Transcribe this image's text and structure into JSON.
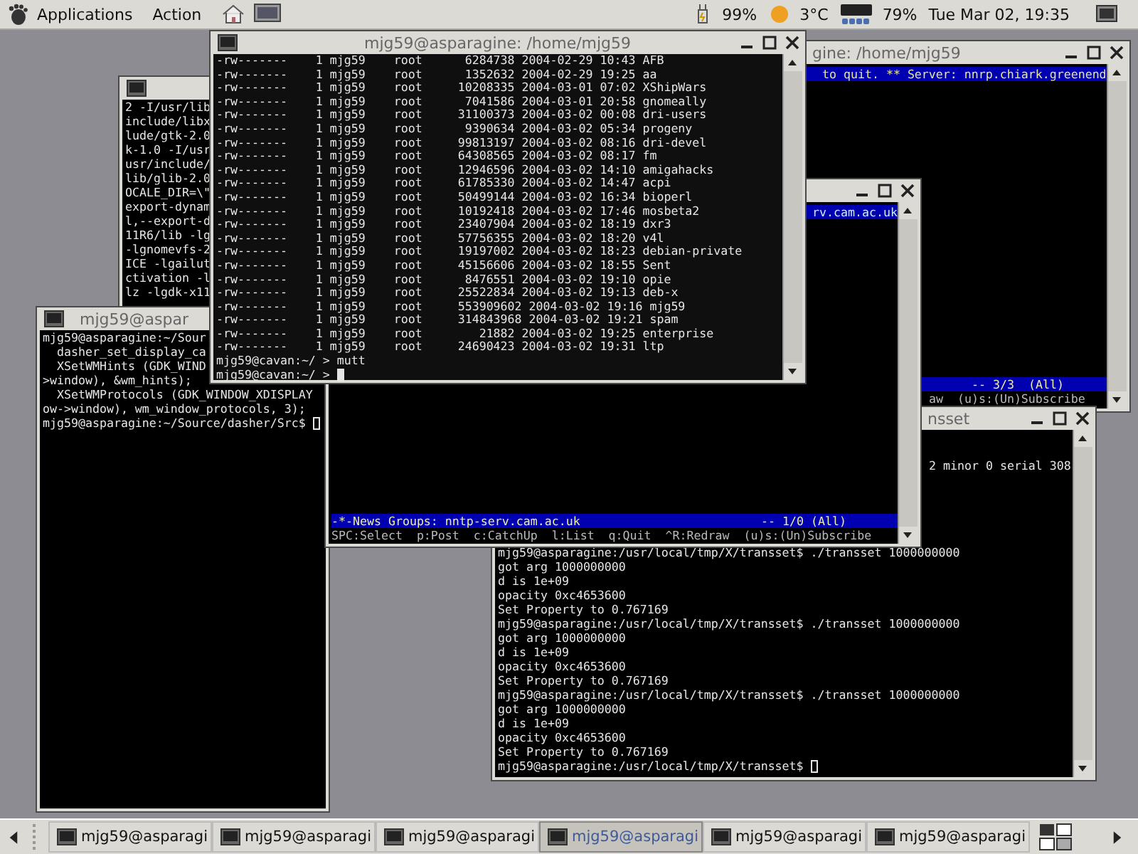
{
  "panel": {
    "menus": [
      "Applications",
      "Action"
    ],
    "battery": "99%",
    "temperature": "3°C",
    "wifi": "79%",
    "clock": "Tue Mar 02, 19:35"
  },
  "windows": [
    {
      "kind": "build_output",
      "lines": [
        "2 -I/usr/lib",
        "include/libx",
        "lude/gtk-2.0",
        "k-1.0 -I/usr",
        "usr/include/",
        "lib/glib-2.0",
        "OCALE_DIR=\\\"",
        "export-dynam",
        "l,--export-d",
        "11R6/lib -lg",
        "-lgnomevfs-2",
        "ICE -lgailut",
        "ctivation -l",
        "lz -lgdk-x11"
      ]
    },
    {
      "kind": "dasher",
      "title": "mjg59@aspar",
      "lines": [
        "mjg59@asparagine:~/Sour",
        "  dasher_set_display_ca",
        "  XSetWMHints (GDK_WIND",
        ">window), &wm_hints);",
        "  XSetWMProtocols (GDK_WINDOW_XDISPLAY",
        "ow->window), wm_window_protocols, 3);",
        "mjg59@asparagine:~/Source/dasher/Src$ "
      ]
    },
    {
      "kind": "news_top",
      "title": "gine: /home/mjg59",
      "header": "to quit. ** Server: nnrp.chiark.greenend",
      "status": "-- 3/3  (All)",
      "help": "aw  (u)s:(Un)Subscribe"
    },
    {
      "kind": "transset",
      "title": "nsset",
      "partial_line": "2 minor 0 serial 308",
      "lines": [
        "mjg59@asparagine:/usr/local/tmp/X/transset$ ./transset 1000000000",
        "got arg 1000000000",
        "d is 1e+09",
        "opacity 0xc4653600",
        "Set Property to 0.767169",
        "mjg59@asparagine:/usr/local/tmp/X/transset$ ./transset 1000000000",
        "got arg 1000000000",
        "d is 1e+09",
        "opacity 0xc4653600",
        "Set Property to 0.767169",
        "mjg59@asparagine:/usr/local/tmp/X/transset$ ./transset 1000000000",
        "got arg 1000000000",
        "d is 1e+09",
        "opacity 0xc4653600",
        "Set Property to 0.767169",
        "mjg59@asparagine:/usr/local/tmp/X/transset$ "
      ]
    },
    {
      "kind": "news_middle",
      "header": "rv.cam.ac.uk",
      "status_left": "-*-News Groups: nntp-serv.cam.ac.uk",
      "status_right": "-- 1/0 (All)",
      "help": "SPC:Select  p:Post  c:CatchUp  l:List  q:Quit  ^R:Redraw  (u)s:(Un)Subscribe"
    },
    {
      "kind": "listing",
      "title": "mjg59@asparagine: /home/mjg59",
      "lines": [
        "-rw-------    1 mjg59    root      6284738 2004-02-29 10:43 AFB",
        "-rw-------    1 mjg59    root      1352632 2004-02-29 19:25 aa",
        "-rw-------    1 mjg59    root     10208335 2004-03-01 07:02 XShipWars",
        "-rw-------    1 mjg59    root      7041586 2004-03-01 20:58 gnomeally",
        "-rw-------    1 mjg59    root     31100373 2004-03-02 00:08 dri-users",
        "-rw-------    1 mjg59    root      9390634 2004-03-02 05:34 progeny",
        "-rw-------    1 mjg59    root     99813197 2004-03-02 08:16 dri-devel",
        "-rw-------    1 mjg59    root     64308565 2004-03-02 08:17 fm",
        "-rw-------    1 mjg59    root     12946596 2004-03-02 14:10 amigahacks",
        "-rw-------    1 mjg59    root     61785330 2004-03-02 14:47 acpi",
        "-rw-------    1 mjg59    root     50499144 2004-03-02 16:34 bioperl",
        "-rw-------    1 mjg59    root     10192418 2004-03-02 17:46 mosbeta2",
        "-rw-------    1 mjg59    root     23407904 2004-03-02 18:19 dxr3",
        "-rw-------    1 mjg59    root     57756355 2004-03-02 18:20 v4l",
        "-rw-------    1 mjg59    root     19197002 2004-03-02 18:23 debian-private",
        "-rw-------    1 mjg59    root     45156606 2004-03-02 18:55 Sent",
        "-rw-------    1 mjg59    root      8476551 2004-03-02 19:10 opie",
        "-rw-------    1 mjg59    root     25522834 2004-03-02 19:13 deb-x",
        "-rw-------    1 mjg59    root     553909602 2004-03-02 19:16 mjg59",
        "-rw-------    1 mjg59    root     314843968 2004-03-02 19:21 spam",
        "-rw-------    1 mjg59    root        21882 2004-03-02 19:25 enterprise",
        "-rw-------    1 mjg59    root     24690423 2004-03-02 19:31 ltp",
        "mjg59@cavan:~/ > mutt",
        "mjg59@cavan:~/ > "
      ]
    }
  ],
  "taskbar": {
    "tasks": [
      {
        "label": "mjg59@asparagi",
        "selected": false
      },
      {
        "label": "mjg59@asparagi",
        "selected": false
      },
      {
        "label": "mjg59@asparagi",
        "selected": false
      },
      {
        "label": "mjg59@asparagi",
        "selected": true
      },
      {
        "label": "mjg59@asparagi",
        "selected": false
      },
      {
        "label": "mjg59@asparagi",
        "selected": false
      }
    ]
  }
}
